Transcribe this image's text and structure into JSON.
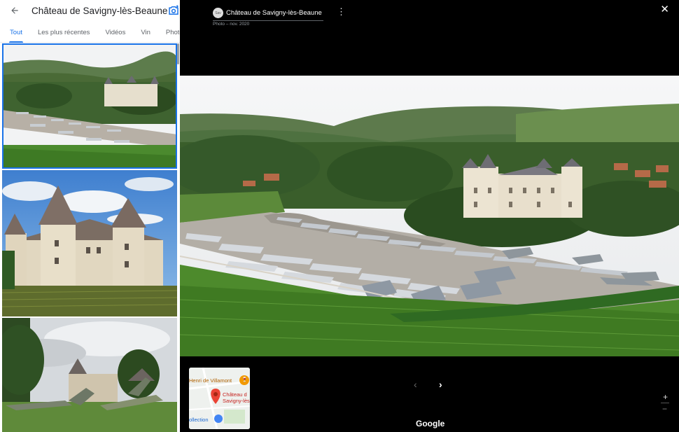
{
  "left_panel": {
    "title": "Château de Savigny-lès-Beaune",
    "tabs": [
      "Tout",
      "Les plus récentes",
      "Vidéos",
      "Vin",
      "Photos"
    ],
    "active_tab": "Tout"
  },
  "viewer": {
    "contributor_title": "Château de Savigny-lès-Beaune",
    "subtitle": "Photo – nov. 2020",
    "kebab": "⋮",
    "close": "✕",
    "prev": "‹",
    "next": "›",
    "zoom_in": "+",
    "zoom_out": "−",
    "attribution": "Google",
    "avatar_text": "Sav"
  },
  "minimap": {
    "label_top": "Henri de Villamont",
    "label_pin_1": "Château d",
    "label_pin_2": "Savigny-lès",
    "label_bottom": "ollection"
  },
  "icons": {
    "back": "back-arrow-icon",
    "camera": "camera-add-icon",
    "map_pin": "map-pin-icon",
    "wine": "wine-icon",
    "museum": "museum-icon"
  },
  "colors": {
    "accent": "#1a73e8",
    "pin": "#ea4335"
  }
}
